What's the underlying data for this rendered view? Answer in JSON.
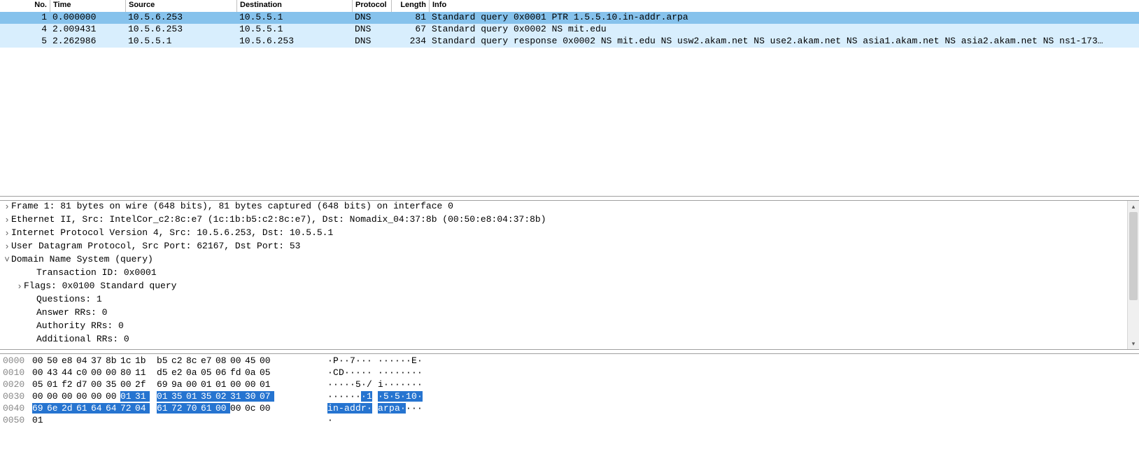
{
  "packet_list": {
    "columns": [
      "No.",
      "Time",
      "Source",
      "Destination",
      "Protocol",
      "Length",
      "Info"
    ],
    "rows": [
      {
        "no": "1",
        "time": "0.000000",
        "source": "10.5.6.253",
        "destination": "10.5.5.1",
        "protocol": "DNS",
        "length": "81",
        "info": "Standard query 0x0001 PTR 1.5.5.10.in-addr.arpa",
        "state": "selected"
      },
      {
        "no": "4",
        "time": "2.009431",
        "source": "10.5.6.253",
        "destination": "10.5.5.1",
        "protocol": "DNS",
        "length": "67",
        "info": "Standard query 0x0002 NS mit.edu",
        "state": "dns-even"
      },
      {
        "no": "5",
        "time": "2.262986",
        "source": "10.5.5.1",
        "destination": "10.5.6.253",
        "protocol": "DNS",
        "length": "234",
        "info": "Standard query response 0x0002 NS mit.edu NS usw2.akam.net NS use2.akam.net NS asia1.akam.net NS asia2.akam.net NS ns1-173…",
        "state": "dns-even"
      }
    ]
  },
  "details": [
    {
      "indent": 0,
      "twisty": ">",
      "text": "Frame 1: 81 bytes on wire (648 bits), 81 bytes captured (648 bits) on interface 0"
    },
    {
      "indent": 0,
      "twisty": ">",
      "text": "Ethernet II, Src: IntelCor_c2:8c:e7 (1c:1b:b5:c2:8c:e7), Dst: Nomadix_04:37:8b (00:50:e8:04:37:8b)"
    },
    {
      "indent": 0,
      "twisty": ">",
      "text": "Internet Protocol Version 4, Src: 10.5.6.253, Dst: 10.5.5.1"
    },
    {
      "indent": 0,
      "twisty": ">",
      "text": "User Datagram Protocol, Src Port: 62167, Dst Port: 53"
    },
    {
      "indent": 0,
      "twisty": "v",
      "text": "Domain Name System (query)"
    },
    {
      "indent": 2,
      "twisty": "",
      "text": "Transaction ID: 0x0001"
    },
    {
      "indent": 1,
      "twisty": ">",
      "text": "Flags: 0x0100 Standard query"
    },
    {
      "indent": 2,
      "twisty": "",
      "text": "Questions: 1"
    },
    {
      "indent": 2,
      "twisty": "",
      "text": "Answer RRs: 0"
    },
    {
      "indent": 2,
      "twisty": "",
      "text": "Authority RRs: 0"
    },
    {
      "indent": 2,
      "twisty": "",
      "text": "Additional RRs: 0"
    }
  ],
  "hex": [
    {
      "offset": "0000",
      "bytes": [
        "00",
        "50",
        "e8",
        "04",
        "37",
        "8b",
        "1c",
        "1b",
        "b5",
        "c2",
        "8c",
        "e7",
        "08",
        "00",
        "45",
        "00"
      ],
      "hl": [
        0,
        0,
        0,
        0,
        0,
        0,
        0,
        0,
        0,
        0,
        0,
        0,
        0,
        0,
        0,
        0
      ],
      "ascii": [
        ".",
        "P",
        ".",
        ".",
        "7",
        ".",
        ".",
        ".",
        ".",
        ".",
        ".",
        ".",
        ".",
        ".",
        "E",
        "."
      ],
      "ahl": [
        0,
        0,
        0,
        0,
        0,
        0,
        0,
        0,
        0,
        0,
        0,
        0,
        0,
        0,
        0,
        0
      ]
    },
    {
      "offset": "0010",
      "bytes": [
        "00",
        "43",
        "44",
        "c0",
        "00",
        "00",
        "80",
        "11",
        "d5",
        "e2",
        "0a",
        "05",
        "06",
        "fd",
        "0a",
        "05"
      ],
      "hl": [
        0,
        0,
        0,
        0,
        0,
        0,
        0,
        0,
        0,
        0,
        0,
        0,
        0,
        0,
        0,
        0
      ],
      "ascii": [
        ".",
        "C",
        "D",
        ".",
        ".",
        ".",
        ".",
        ".",
        ".",
        ".",
        ".",
        ".",
        ".",
        ".",
        ".",
        "."
      ],
      "ahl": [
        0,
        0,
        0,
        0,
        0,
        0,
        0,
        0,
        0,
        0,
        0,
        0,
        0,
        0,
        0,
        0
      ]
    },
    {
      "offset": "0020",
      "bytes": [
        "05",
        "01",
        "f2",
        "d7",
        "00",
        "35",
        "00",
        "2f",
        "69",
        "9a",
        "00",
        "01",
        "01",
        "00",
        "00",
        "01"
      ],
      "hl": [
        0,
        0,
        0,
        0,
        0,
        0,
        0,
        0,
        0,
        0,
        0,
        0,
        0,
        0,
        0,
        0
      ],
      "ascii": [
        ".",
        ".",
        ".",
        ".",
        ".",
        "5",
        ".",
        "/",
        "i",
        ".",
        ".",
        ".",
        ".",
        ".",
        ".",
        "."
      ],
      "ahl": [
        0,
        0,
        0,
        0,
        0,
        0,
        0,
        0,
        0,
        0,
        0,
        0,
        0,
        0,
        0,
        0
      ]
    },
    {
      "offset": "0030",
      "bytes": [
        "00",
        "00",
        "00",
        "00",
        "00",
        "00",
        "01",
        "31",
        "01",
        "35",
        "01",
        "35",
        "02",
        "31",
        "30",
        "07"
      ],
      "hl": [
        0,
        0,
        0,
        0,
        0,
        0,
        1,
        1,
        1,
        1,
        1,
        1,
        1,
        1,
        1,
        1
      ],
      "ascii": [
        ".",
        ".",
        ".",
        ".",
        ".",
        ".",
        ".",
        "1",
        ".",
        "5",
        ".",
        "5",
        ".",
        "1",
        "0",
        "."
      ],
      "ahl": [
        0,
        0,
        0,
        0,
        0,
        0,
        1,
        1,
        1,
        1,
        1,
        1,
        1,
        1,
        1,
        1
      ]
    },
    {
      "offset": "0040",
      "bytes": [
        "69",
        "6e",
        "2d",
        "61",
        "64",
        "64",
        "72",
        "04",
        "61",
        "72",
        "70",
        "61",
        "00",
        "00",
        "0c",
        "00"
      ],
      "hl": [
        1,
        1,
        1,
        1,
        1,
        1,
        1,
        1,
        1,
        1,
        1,
        1,
        1,
        0,
        0,
        0
      ],
      "ascii": [
        "i",
        "n",
        "-",
        "a",
        "d",
        "d",
        "r",
        ".",
        "a",
        "r",
        "p",
        "a",
        ".",
        ".",
        ".",
        "."
      ],
      "ahl": [
        1,
        1,
        1,
        1,
        1,
        1,
        1,
        1,
        1,
        1,
        1,
        1,
        1,
        0,
        0,
        0
      ]
    },
    {
      "offset": "0050",
      "bytes": [
        "01"
      ],
      "hl": [
        0
      ],
      "ascii": [
        "."
      ],
      "ahl": [
        0
      ]
    }
  ]
}
